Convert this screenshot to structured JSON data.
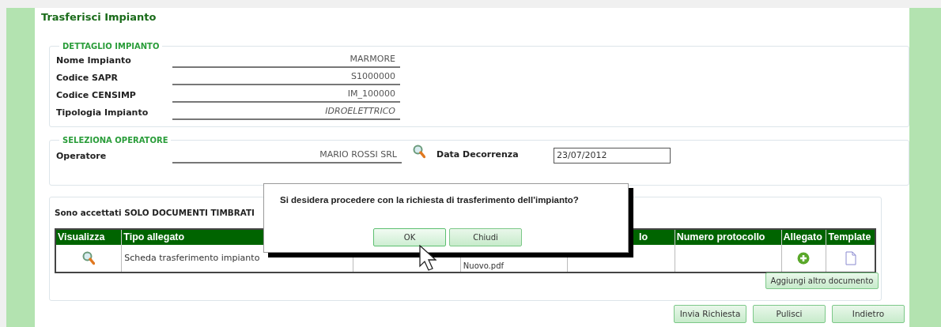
{
  "page": {
    "title": "Trasferisci Impianto"
  },
  "dettaglio": {
    "legend": "DETTAGLIO IMPIANTO",
    "fields": [
      {
        "label": "Nome Impianto",
        "value": "MARMORE",
        "kind": "plain"
      },
      {
        "label": "Codice SAPR",
        "value": "S1000000",
        "kind": "plain"
      },
      {
        "label": "Codice CENSIMP",
        "value": "IM_100000",
        "kind": "plain"
      },
      {
        "label": "Tipologia Impianto",
        "value": "IDROELETTRICO",
        "kind": "italic"
      }
    ]
  },
  "operatore": {
    "legend": "SELEZIONA OPERATORE",
    "label": "Operatore",
    "value": "MARIO ROSSI SRL",
    "date_label": "Data Decorrenza",
    "date_value": "23/07/2012"
  },
  "documenti": {
    "notice": "Sono accettati SOLO DOCUMENTI TIMBRATI",
    "columns": [
      {
        "label": "Visualizza"
      },
      {
        "label": "Tipo allegato"
      },
      {},
      {},
      {
        "label": "lo"
      },
      {
        "label": "Numero protocollo"
      },
      {
        "label": "Allegato"
      },
      {
        "label": "Template"
      }
    ],
    "rows": [
      {
        "tipo": "Scheda trasferimento impianto",
        "file": "Nuovo.pdf"
      }
    ],
    "add_button": "Aggiungi altro documento"
  },
  "actions": [
    "Invia Richiesta",
    "Pulisci",
    "Indietro"
  ],
  "dialog": {
    "message": "Si desidera procedere con la richiesta di trasferimento dell'impianto?",
    "buttons": [
      {
        "label": "OK",
        "selected": true
      },
      {
        "label": "Chiudi",
        "selected": false
      }
    ]
  }
}
